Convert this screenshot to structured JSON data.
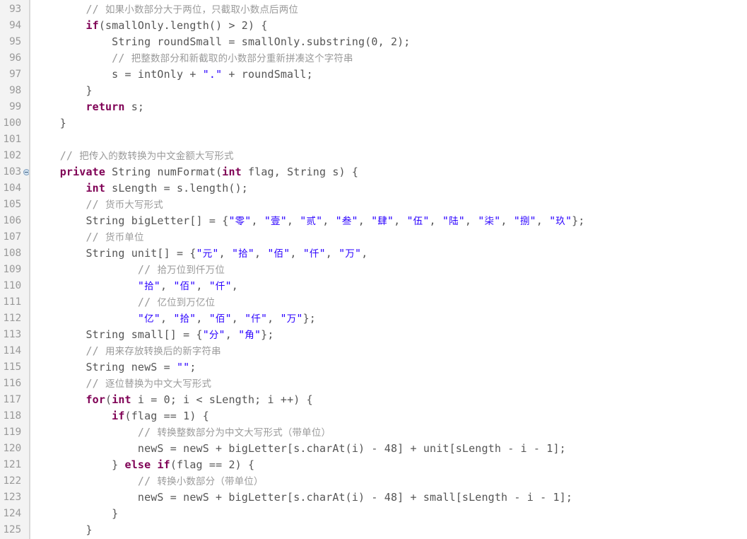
{
  "editor": {
    "kind": "java-source-code-editor",
    "language": "Java",
    "first_line_number": 93,
    "last_line_number": 125,
    "colors": {
      "background": "#ffffff",
      "gutter_background": "#f3f3f3",
      "gutter_border": "#d8d8d8",
      "line_number": "#9a9a9a",
      "plain_text": "#555555",
      "keyword": "#7f0055",
      "string": "#2a00ff",
      "comment": "#9a9a9a",
      "fold_marker": "#cfe0ef"
    },
    "fold_marker_line": 103,
    "fold_marker_icon": "minus-circle-icon"
  },
  "lines": [
    {
      "number": "93",
      "fold": false,
      "tokens": [
        {
          "t": "cmt",
          "v": "        // "
        },
        {
          "t": "cmt-cjk",
          "v": "如果小数部分大于两位，只截取小数点后两位"
        }
      ]
    },
    {
      "number": "94",
      "fold": false,
      "tokens": [
        {
          "t": "pln",
          "v": "        "
        },
        {
          "t": "kw",
          "v": "if"
        },
        {
          "t": "pln",
          "v": "(smallOnly.length() > 2) {"
        }
      ]
    },
    {
      "number": "95",
      "fold": false,
      "tokens": [
        {
          "t": "pln",
          "v": "            String roundSmall = smallOnly.substring(0, 2);"
        }
      ]
    },
    {
      "number": "96",
      "fold": false,
      "tokens": [
        {
          "t": "cmt",
          "v": "            // "
        },
        {
          "t": "cmt-cjk",
          "v": "把整数部分和新截取的小数部分重新拼凑这个字符串"
        }
      ]
    },
    {
      "number": "97",
      "fold": false,
      "tokens": [
        {
          "t": "pln",
          "v": "            s = intOnly + "
        },
        {
          "t": "str",
          "v": "\".\""
        },
        {
          "t": "pln",
          "v": " + roundSmall;"
        }
      ]
    },
    {
      "number": "98",
      "fold": false,
      "tokens": [
        {
          "t": "pln",
          "v": "        }"
        }
      ]
    },
    {
      "number": "99",
      "fold": false,
      "tokens": [
        {
          "t": "pln",
          "v": "        "
        },
        {
          "t": "kw",
          "v": "return"
        },
        {
          "t": "pln",
          "v": " s;"
        }
      ]
    },
    {
      "number": "100",
      "fold": false,
      "tokens": [
        {
          "t": "pln",
          "v": "    }"
        }
      ]
    },
    {
      "number": "101",
      "fold": false,
      "tokens": [
        {
          "t": "pln",
          "v": ""
        }
      ]
    },
    {
      "number": "102",
      "fold": false,
      "tokens": [
        {
          "t": "cmt",
          "v": "    // "
        },
        {
          "t": "cmt-cjk",
          "v": "把传入的数转换为中文金额大写形式"
        }
      ]
    },
    {
      "number": "103",
      "fold": true,
      "tokens": [
        {
          "t": "pln",
          "v": "    "
        },
        {
          "t": "kw",
          "v": "private"
        },
        {
          "t": "pln",
          "v": " String numFormat("
        },
        {
          "t": "kw",
          "v": "int"
        },
        {
          "t": "pln",
          "v": " flag, String s) {"
        }
      ]
    },
    {
      "number": "104",
      "fold": false,
      "tokens": [
        {
          "t": "pln",
          "v": "        "
        },
        {
          "t": "kw",
          "v": "int"
        },
        {
          "t": "pln",
          "v": " sLength = s.length();"
        }
      ]
    },
    {
      "number": "105",
      "fold": false,
      "tokens": [
        {
          "t": "cmt",
          "v": "        // "
        },
        {
          "t": "cmt-cjk",
          "v": "货币大写形式"
        }
      ]
    },
    {
      "number": "106",
      "fold": false,
      "tokens": [
        {
          "t": "pln",
          "v": "        String bigLetter[] = {"
        },
        {
          "t": "str",
          "v": "\""
        },
        {
          "t": "str-cjk",
          "v": "零"
        },
        {
          "t": "str",
          "v": "\""
        },
        {
          "t": "pln",
          "v": ", "
        },
        {
          "t": "str",
          "v": "\""
        },
        {
          "t": "str-cjk",
          "v": "壹"
        },
        {
          "t": "str",
          "v": "\""
        },
        {
          "t": "pln",
          "v": ", "
        },
        {
          "t": "str",
          "v": "\""
        },
        {
          "t": "str-cjk",
          "v": "贰"
        },
        {
          "t": "str",
          "v": "\""
        },
        {
          "t": "pln",
          "v": ", "
        },
        {
          "t": "str",
          "v": "\""
        },
        {
          "t": "str-cjk",
          "v": "叁"
        },
        {
          "t": "str",
          "v": "\""
        },
        {
          "t": "pln",
          "v": ", "
        },
        {
          "t": "str",
          "v": "\""
        },
        {
          "t": "str-cjk",
          "v": "肆"
        },
        {
          "t": "str",
          "v": "\""
        },
        {
          "t": "pln",
          "v": ", "
        },
        {
          "t": "str",
          "v": "\""
        },
        {
          "t": "str-cjk",
          "v": "伍"
        },
        {
          "t": "str",
          "v": "\""
        },
        {
          "t": "pln",
          "v": ", "
        },
        {
          "t": "str",
          "v": "\""
        },
        {
          "t": "str-cjk",
          "v": "陆"
        },
        {
          "t": "str",
          "v": "\""
        },
        {
          "t": "pln",
          "v": ", "
        },
        {
          "t": "str",
          "v": "\""
        },
        {
          "t": "str-cjk",
          "v": "柒"
        },
        {
          "t": "str",
          "v": "\""
        },
        {
          "t": "pln",
          "v": ", "
        },
        {
          "t": "str",
          "v": "\""
        },
        {
          "t": "str-cjk",
          "v": "捌"
        },
        {
          "t": "str",
          "v": "\""
        },
        {
          "t": "pln",
          "v": ", "
        },
        {
          "t": "str",
          "v": "\""
        },
        {
          "t": "str-cjk",
          "v": "玖"
        },
        {
          "t": "str",
          "v": "\""
        },
        {
          "t": "pln",
          "v": "};"
        }
      ]
    },
    {
      "number": "107",
      "fold": false,
      "tokens": [
        {
          "t": "cmt",
          "v": "        // "
        },
        {
          "t": "cmt-cjk",
          "v": "货币单位"
        }
      ]
    },
    {
      "number": "108",
      "fold": false,
      "tokens": [
        {
          "t": "pln",
          "v": "        String unit[] = {"
        },
        {
          "t": "str",
          "v": "\""
        },
        {
          "t": "str-cjk",
          "v": "元"
        },
        {
          "t": "str",
          "v": "\""
        },
        {
          "t": "pln",
          "v": ", "
        },
        {
          "t": "str",
          "v": "\""
        },
        {
          "t": "str-cjk",
          "v": "拾"
        },
        {
          "t": "str",
          "v": "\""
        },
        {
          "t": "pln",
          "v": ", "
        },
        {
          "t": "str",
          "v": "\""
        },
        {
          "t": "str-cjk",
          "v": "佰"
        },
        {
          "t": "str",
          "v": "\""
        },
        {
          "t": "pln",
          "v": ", "
        },
        {
          "t": "str",
          "v": "\""
        },
        {
          "t": "str-cjk",
          "v": "仟"
        },
        {
          "t": "str",
          "v": "\""
        },
        {
          "t": "pln",
          "v": ", "
        },
        {
          "t": "str",
          "v": "\""
        },
        {
          "t": "str-cjk",
          "v": "万"
        },
        {
          "t": "str",
          "v": "\""
        },
        {
          "t": "pln",
          "v": ","
        }
      ]
    },
    {
      "number": "109",
      "fold": false,
      "tokens": [
        {
          "t": "cmt",
          "v": "                // "
        },
        {
          "t": "cmt-cjk",
          "v": "拾万位到仟万位"
        }
      ]
    },
    {
      "number": "110",
      "fold": false,
      "tokens": [
        {
          "t": "pln",
          "v": "                "
        },
        {
          "t": "str",
          "v": "\""
        },
        {
          "t": "str-cjk",
          "v": "拾"
        },
        {
          "t": "str",
          "v": "\""
        },
        {
          "t": "pln",
          "v": ", "
        },
        {
          "t": "str",
          "v": "\""
        },
        {
          "t": "str-cjk",
          "v": "佰"
        },
        {
          "t": "str",
          "v": "\""
        },
        {
          "t": "pln",
          "v": ", "
        },
        {
          "t": "str",
          "v": "\""
        },
        {
          "t": "str-cjk",
          "v": "仟"
        },
        {
          "t": "str",
          "v": "\""
        },
        {
          "t": "pln",
          "v": ","
        }
      ]
    },
    {
      "number": "111",
      "fold": false,
      "tokens": [
        {
          "t": "cmt",
          "v": "                // "
        },
        {
          "t": "cmt-cjk",
          "v": "亿位到万亿位"
        }
      ]
    },
    {
      "number": "112",
      "fold": false,
      "tokens": [
        {
          "t": "pln",
          "v": "                "
        },
        {
          "t": "str",
          "v": "\""
        },
        {
          "t": "str-cjk",
          "v": "亿"
        },
        {
          "t": "str",
          "v": "\""
        },
        {
          "t": "pln",
          "v": ", "
        },
        {
          "t": "str",
          "v": "\""
        },
        {
          "t": "str-cjk",
          "v": "拾"
        },
        {
          "t": "str",
          "v": "\""
        },
        {
          "t": "pln",
          "v": ", "
        },
        {
          "t": "str",
          "v": "\""
        },
        {
          "t": "str-cjk",
          "v": "佰"
        },
        {
          "t": "str",
          "v": "\""
        },
        {
          "t": "pln",
          "v": ", "
        },
        {
          "t": "str",
          "v": "\""
        },
        {
          "t": "str-cjk",
          "v": "仟"
        },
        {
          "t": "str",
          "v": "\""
        },
        {
          "t": "pln",
          "v": ", "
        },
        {
          "t": "str",
          "v": "\""
        },
        {
          "t": "str-cjk",
          "v": "万"
        },
        {
          "t": "str",
          "v": "\""
        },
        {
          "t": "pln",
          "v": "};"
        }
      ]
    },
    {
      "number": "113",
      "fold": false,
      "tokens": [
        {
          "t": "pln",
          "v": "        String small[] = {"
        },
        {
          "t": "str",
          "v": "\""
        },
        {
          "t": "str-cjk",
          "v": "分"
        },
        {
          "t": "str",
          "v": "\""
        },
        {
          "t": "pln",
          "v": ", "
        },
        {
          "t": "str",
          "v": "\""
        },
        {
          "t": "str-cjk",
          "v": "角"
        },
        {
          "t": "str",
          "v": "\""
        },
        {
          "t": "pln",
          "v": "};"
        }
      ]
    },
    {
      "number": "114",
      "fold": false,
      "tokens": [
        {
          "t": "cmt",
          "v": "        // "
        },
        {
          "t": "cmt-cjk",
          "v": "用来存放转换后的新字符串"
        }
      ]
    },
    {
      "number": "115",
      "fold": false,
      "tokens": [
        {
          "t": "pln",
          "v": "        String newS = "
        },
        {
          "t": "str",
          "v": "\"\""
        },
        {
          "t": "pln",
          "v": ";"
        }
      ]
    },
    {
      "number": "116",
      "fold": false,
      "tokens": [
        {
          "t": "cmt",
          "v": "        // "
        },
        {
          "t": "cmt-cjk",
          "v": "逐位替换为中文大写形式"
        }
      ]
    },
    {
      "number": "117",
      "fold": false,
      "tokens": [
        {
          "t": "pln",
          "v": "        "
        },
        {
          "t": "kw",
          "v": "for"
        },
        {
          "t": "pln",
          "v": "("
        },
        {
          "t": "kw",
          "v": "int"
        },
        {
          "t": "pln",
          "v": " i = 0; i < sLength; i ++) {"
        }
      ]
    },
    {
      "number": "118",
      "fold": false,
      "tokens": [
        {
          "t": "pln",
          "v": "            "
        },
        {
          "t": "kw",
          "v": "if"
        },
        {
          "t": "pln",
          "v": "(flag == 1) {"
        }
      ]
    },
    {
      "number": "119",
      "fold": false,
      "tokens": [
        {
          "t": "cmt",
          "v": "                // "
        },
        {
          "t": "cmt-cjk",
          "v": "转换整数部分为中文大写形式（带单位）"
        }
      ]
    },
    {
      "number": "120",
      "fold": false,
      "tokens": [
        {
          "t": "pln",
          "v": "                newS = newS + bigLetter[s.charAt(i) - 48] + unit[sLength - i - 1];"
        }
      ]
    },
    {
      "number": "121",
      "fold": false,
      "tokens": [
        {
          "t": "pln",
          "v": "            } "
        },
        {
          "t": "kw",
          "v": "else"
        },
        {
          "t": "pln",
          "v": " "
        },
        {
          "t": "kw",
          "v": "if"
        },
        {
          "t": "pln",
          "v": "(flag == 2) {"
        }
      ]
    },
    {
      "number": "122",
      "fold": false,
      "tokens": [
        {
          "t": "cmt",
          "v": "                // "
        },
        {
          "t": "cmt-cjk",
          "v": "转换小数部分（带单位）"
        }
      ]
    },
    {
      "number": "123",
      "fold": false,
      "tokens": [
        {
          "t": "pln",
          "v": "                newS = newS + bigLetter[s.charAt(i) - 48] + small[sLength - i - 1];"
        }
      ]
    },
    {
      "number": "124",
      "fold": false,
      "tokens": [
        {
          "t": "pln",
          "v": "            }"
        }
      ]
    },
    {
      "number": "125",
      "fold": false,
      "tokens": [
        {
          "t": "pln",
          "v": "        }"
        }
      ]
    }
  ]
}
